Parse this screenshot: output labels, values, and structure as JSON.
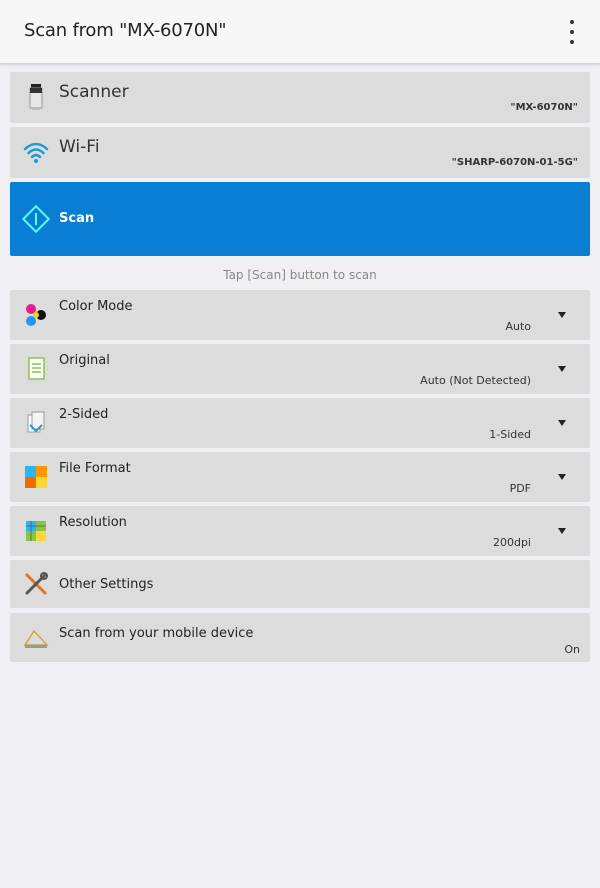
{
  "appbar": {
    "title": "Scan from \"MX-6070N\""
  },
  "scanner": {
    "label": "Scanner",
    "value": "\"MX-6070N\""
  },
  "wifi": {
    "label": "Wi-Fi",
    "value": "\"SHARP-6070N-01-5G\""
  },
  "scan": {
    "label": "Scan"
  },
  "hint": "Tap [Scan] button to scan",
  "settings": [
    {
      "label": "Color Mode",
      "value": "Auto"
    },
    {
      "label": "Original",
      "value": "Auto (Not Detected)"
    },
    {
      "label": "2-Sided",
      "value": "1-Sided"
    },
    {
      "label": "File Format",
      "value": "PDF"
    },
    {
      "label": "Resolution",
      "value": "200dpi"
    }
  ],
  "other_settings": {
    "label": "Other Settings"
  },
  "mobile": {
    "label": "Scan from your mobile device",
    "value": "On"
  },
  "colors": {
    "accent": "#0a7ed4",
    "row_bg": "#dcdcdc",
    "page_bg": "#f0f0f4"
  }
}
